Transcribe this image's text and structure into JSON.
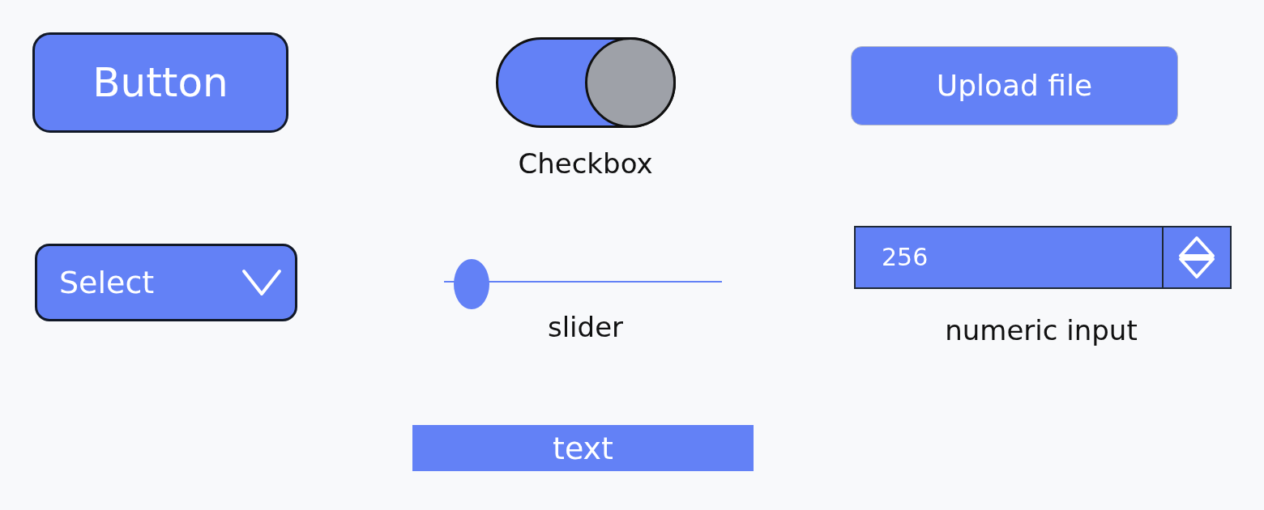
{
  "button": {
    "label": "Button"
  },
  "toggle": {
    "label": "Checkbox",
    "checked": true
  },
  "upload_button": {
    "label": "Upload file"
  },
  "select": {
    "value": "Select"
  },
  "slider": {
    "label": "slider",
    "level": 0.1
  },
  "numeric_input": {
    "value": "256",
    "label": "numeric input"
  },
  "text_input": {
    "value": "text"
  }
}
